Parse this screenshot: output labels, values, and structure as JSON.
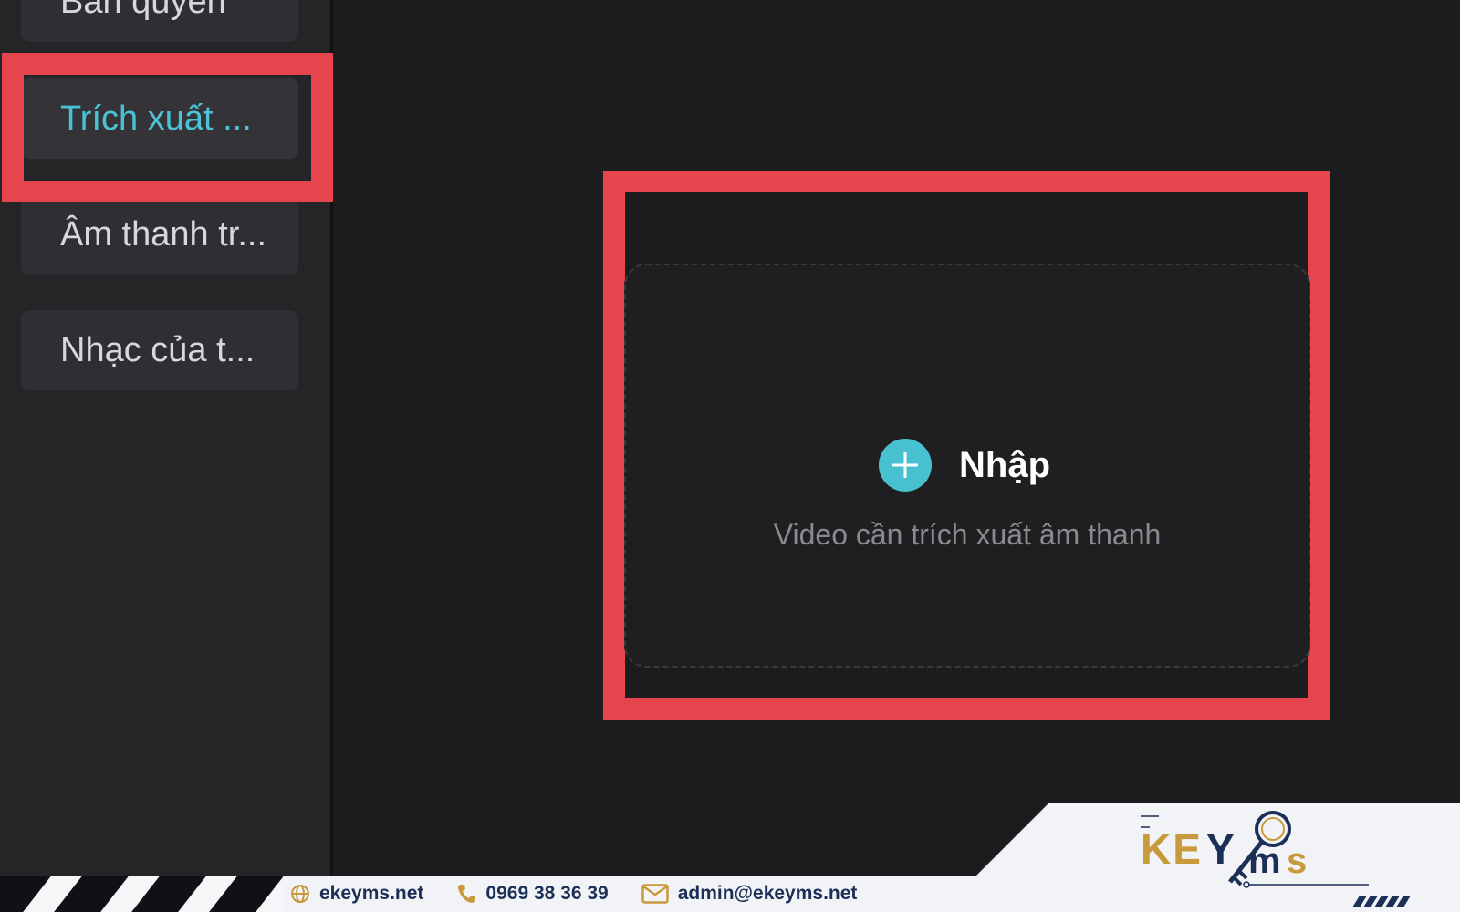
{
  "sidebar": {
    "items": [
      {
        "label": "Bản quyền",
        "active": false
      },
      {
        "label": "Trích xuất ...",
        "active": true
      },
      {
        "label": "Âm thanh tr...",
        "active": false
      },
      {
        "label": "Nhạc của t...",
        "active": false
      }
    ]
  },
  "main": {
    "import_label": "Nhập",
    "hint": "Video cần trích xuất âm thanh"
  },
  "footer": {
    "website": "ekeyms.net",
    "phone": "0969 38 36 39",
    "email": "admin@ekeyms.net",
    "logo_text": "KEYMS"
  },
  "colors": {
    "accent": "#47c1cf",
    "highlight": "#e5464d",
    "brand_navy": "#1b2f57",
    "brand_gold": "#c99a3b"
  }
}
